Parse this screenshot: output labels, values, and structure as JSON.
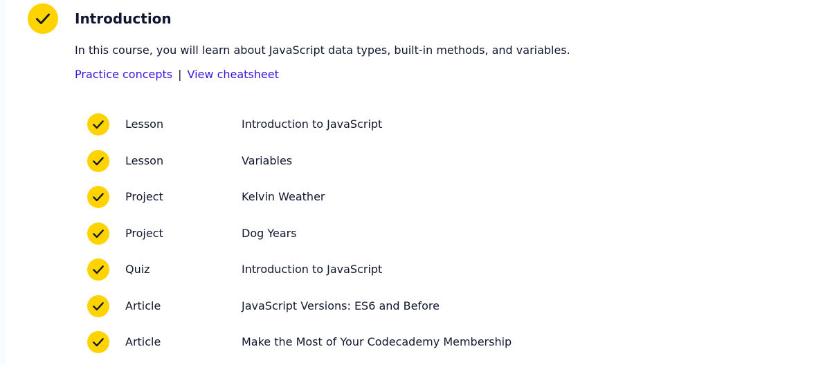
{
  "section": {
    "title": "Introduction",
    "description": "In this course, you will learn about JavaScript data types, built-in methods, and variables.",
    "links": {
      "practice": "Practice concepts",
      "separator": "|",
      "cheatsheet": "View cheatsheet"
    },
    "status_icon": "check-icon"
  },
  "items": [
    {
      "type": "Lesson",
      "name": "Introduction to JavaScript",
      "status_icon": "check-icon"
    },
    {
      "type": "Lesson",
      "name": "Variables",
      "status_icon": "check-icon"
    },
    {
      "type": "Project",
      "name": "Kelvin Weather",
      "status_icon": "check-icon"
    },
    {
      "type": "Project",
      "name": "Dog Years",
      "status_icon": "check-icon"
    },
    {
      "type": "Quiz",
      "name": "Introduction to JavaScript",
      "status_icon": "check-icon"
    },
    {
      "type": "Article",
      "name": "JavaScript Versions: ES6 and Before",
      "status_icon": "check-icon"
    },
    {
      "type": "Article",
      "name": "Make the Most of Your Codecademy Membership",
      "status_icon": "check-icon"
    }
  ],
  "colors": {
    "check_bg": "#ffd300",
    "link": "#3a10e5",
    "text": "#10162f"
  }
}
